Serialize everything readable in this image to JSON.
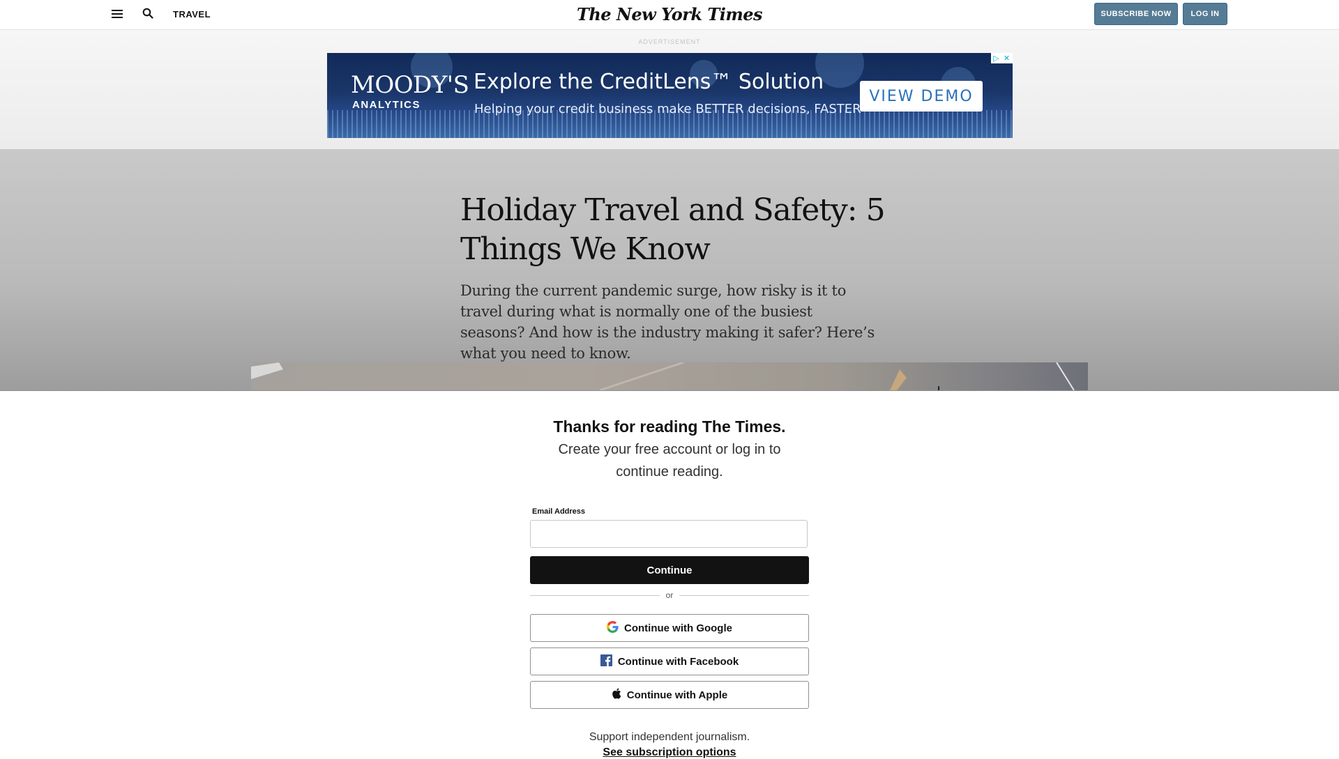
{
  "header": {
    "section": "TRAVEL",
    "logo": "The New York Times",
    "subscribe_label": "SUBSCRIBE NOW",
    "login_label": "LOG IN"
  },
  "ad": {
    "label": "ADVERTISEMENT",
    "brand": "MOODY'S",
    "brand_sub": "ANALYTICS",
    "headline": "Explore the CreditLens™ Solution",
    "subline": "Helping your credit business make BETTER decisions, FASTER",
    "cta": "VIEW DEMO"
  },
  "article": {
    "headline": "Holiday Travel and Safety: 5 Things We Know",
    "summary": "During the current pandemic surge, how risky is it to travel during what is normally one of the busiest seasons? And how is the industry making it safer? Here’s what you need to know."
  },
  "gate": {
    "title": "Thanks for reading The Times.",
    "subtitle": "Create your free account or log in to continue reading.",
    "email_label": "Email Address",
    "email_value": "",
    "continue_label": "Continue",
    "or_label": "or",
    "google_label": "Continue with Google",
    "facebook_label": "Continue with Facebook",
    "apple_label": "Continue with Apple",
    "support_text": "Support independent journalism.",
    "subscription_link": "See subscription options"
  },
  "colors": {
    "subscribe_bg": "#567b95",
    "continue_bg": "#121212",
    "facebook_blue": "#3b5998"
  }
}
